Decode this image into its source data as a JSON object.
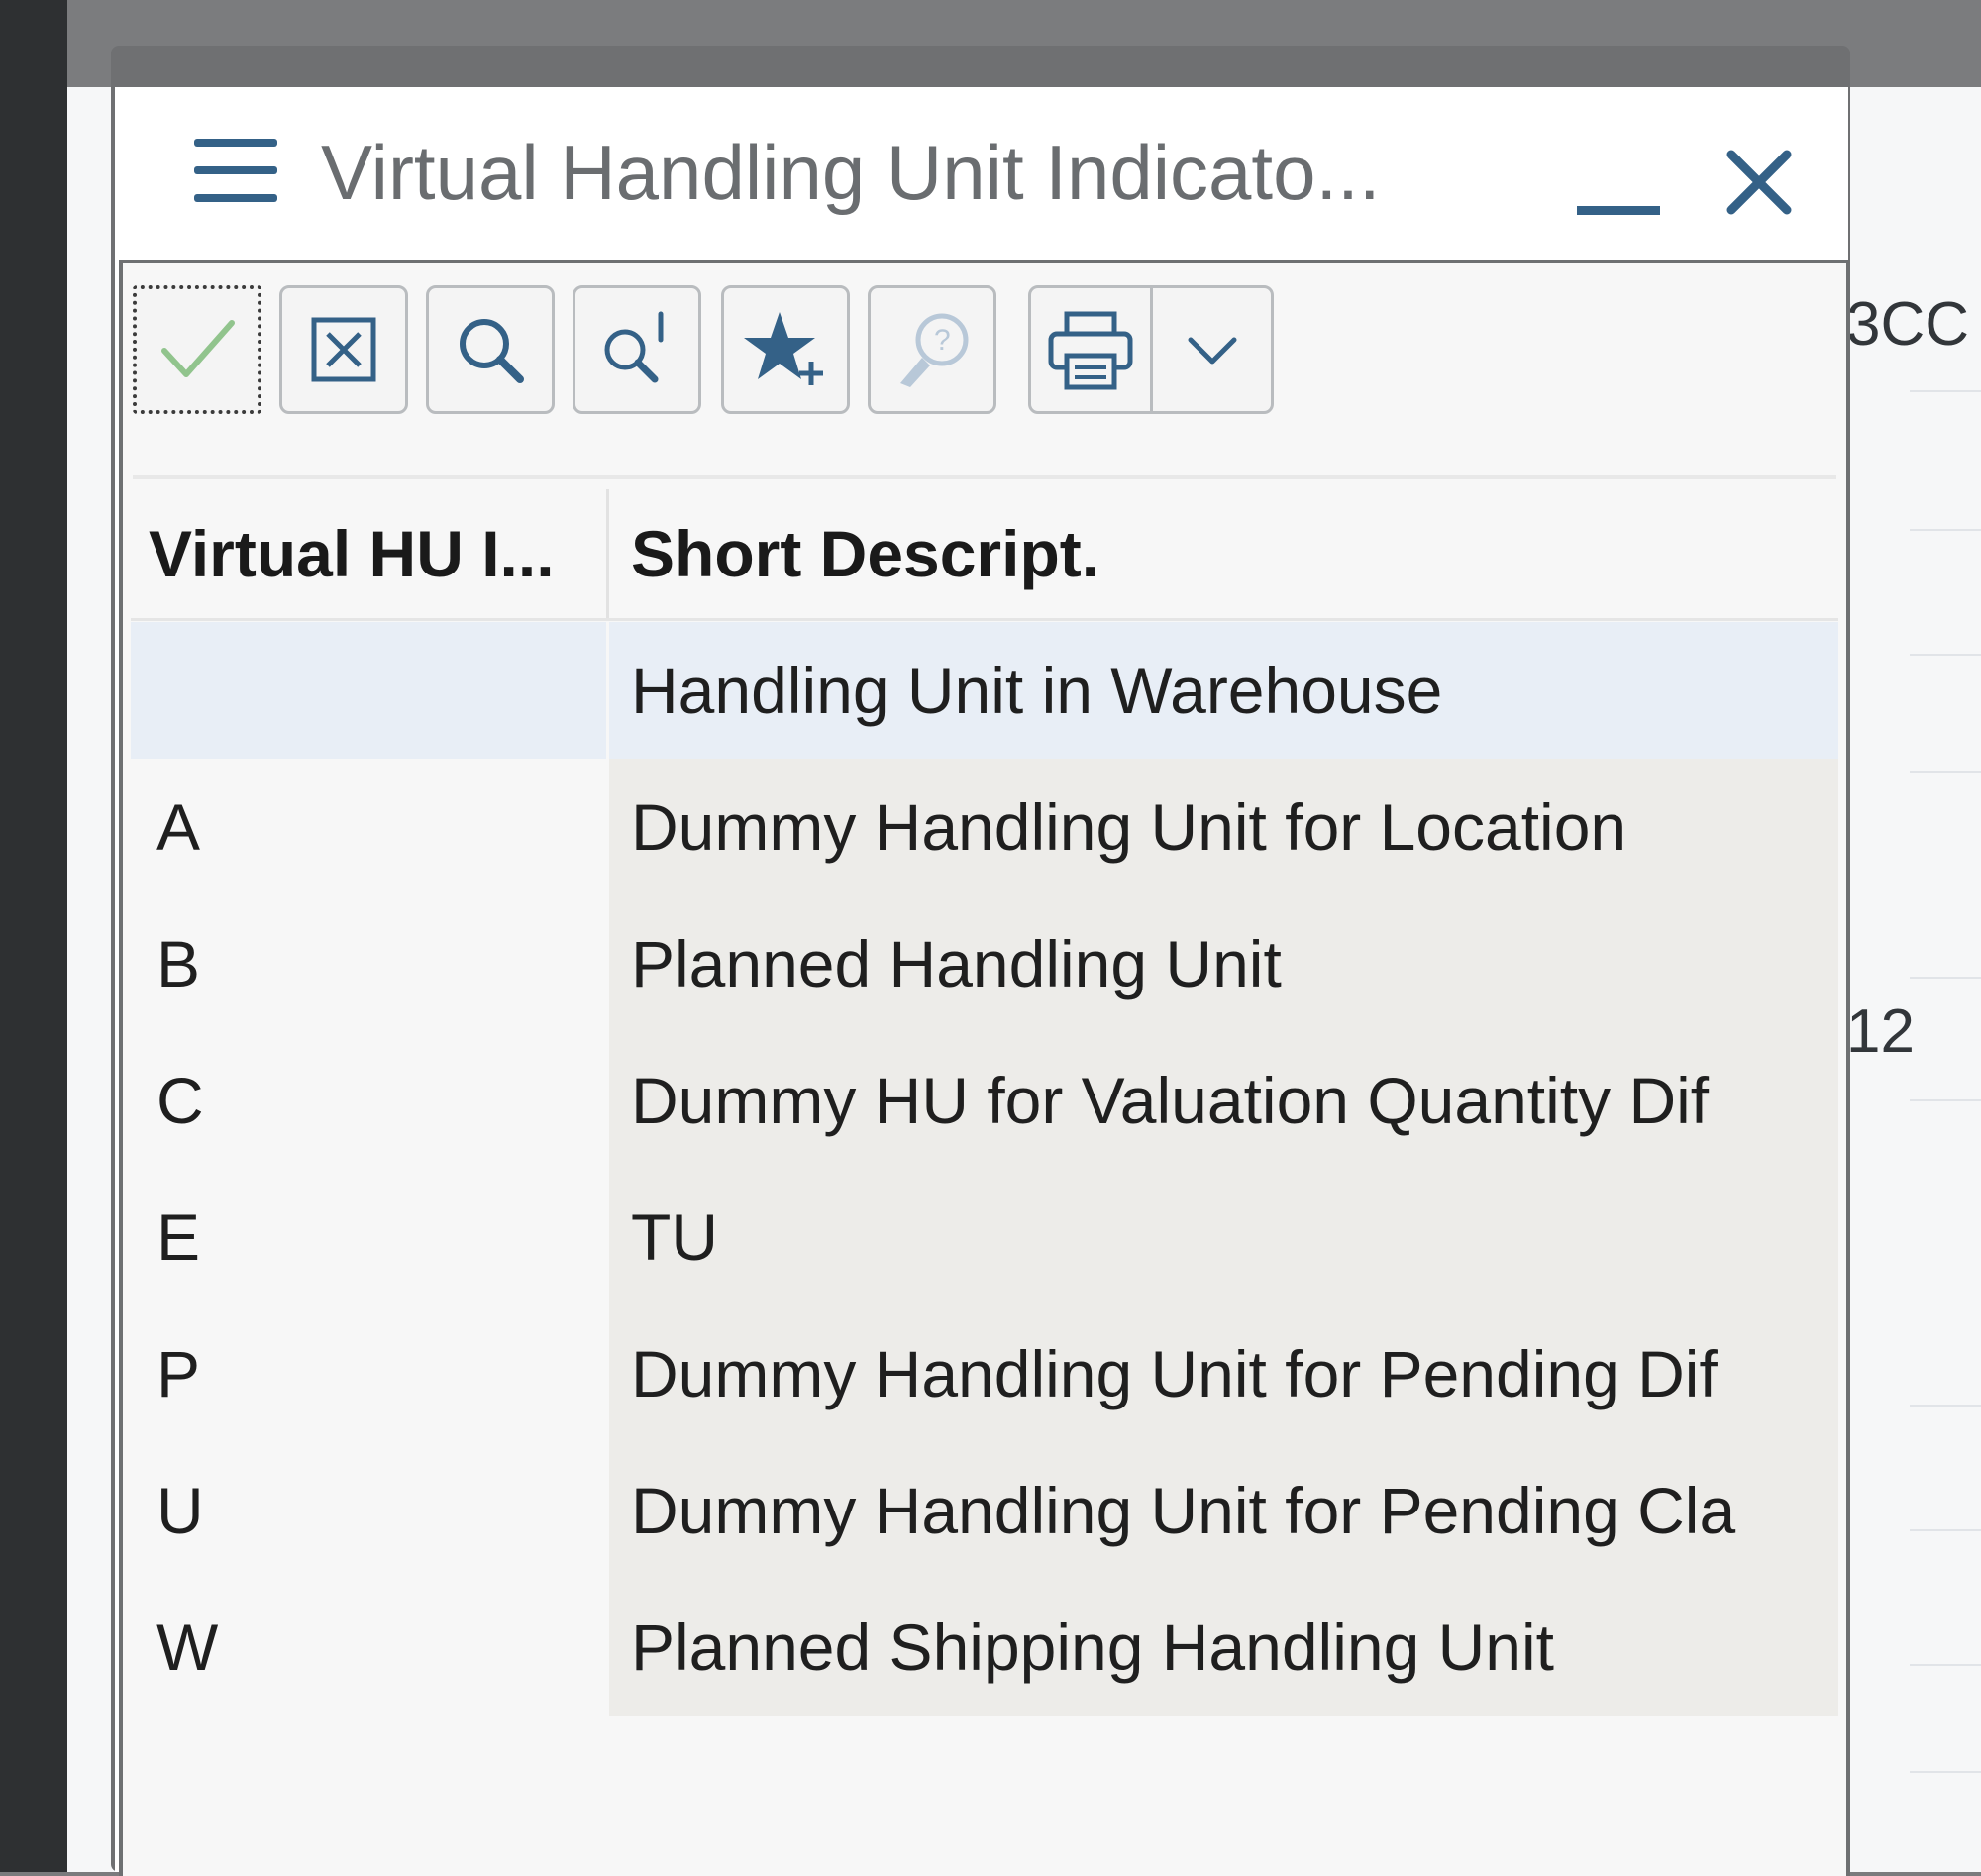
{
  "dialog": {
    "title": "Virtual Handling Unit Indicato...",
    "menu_icon": "hamburger-menu-icon",
    "minimize_icon": "minimize-icon",
    "close_icon": "close-icon"
  },
  "toolbar": {
    "buttons": [
      {
        "icon": "checkmark-icon",
        "state": "focused"
      },
      {
        "icon": "cancel-box-icon"
      },
      {
        "icon": "search-icon"
      },
      {
        "icon": "search-more-icon"
      },
      {
        "icon": "add-favorite-icon"
      },
      {
        "icon": "help-icon",
        "state": "disabled"
      },
      {
        "icon": "print-icon"
      },
      {
        "icon": "chevron-down-icon"
      }
    ]
  },
  "table": {
    "columns": [
      "Virtual HU I...",
      "Short Descript."
    ],
    "rows": [
      {
        "code": "",
        "description": "Handling Unit in Warehouse",
        "selected": true
      },
      {
        "code": "A",
        "description": "Dummy Handling Unit for Location"
      },
      {
        "code": "B",
        "description": "Planned Handling Unit"
      },
      {
        "code": "C",
        "description": "Dummy HU for Valuation Quantity Dif"
      },
      {
        "code": "E",
        "description": "TU"
      },
      {
        "code": "P",
        "description": "Dummy Handling Unit for Pending Dif"
      },
      {
        "code": "U",
        "description": "Dummy Handling Unit for Pending Cla"
      },
      {
        "code": "W",
        "description": "Planned Shipping Handling Unit"
      }
    ]
  },
  "background": {
    "fragment_1": "3CC",
    "fragment_2": "12"
  },
  "colors": {
    "accent": "#346187",
    "check_green": "#91c48d",
    "selected_row": "#e8eef6"
  }
}
